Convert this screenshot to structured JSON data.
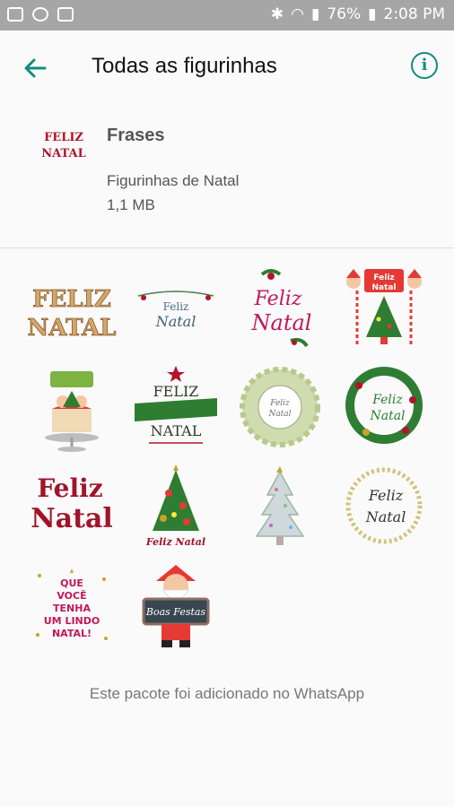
{
  "status_bar": {
    "battery": "76%",
    "time": "2:08 PM"
  },
  "app_bar": {
    "title": "Todas as figurinhas"
  },
  "pack": {
    "name": "Frases",
    "publisher": "Figurinhas de Natal",
    "size": "1,1 MB",
    "thumb_text": [
      "FELIZ",
      "NATAL"
    ]
  },
  "stickers": [
    {
      "text": [
        "FELIZ",
        "NATAL"
      ]
    },
    {
      "text": [
        "Feliz",
        "Natal"
      ]
    },
    {
      "text": [
        "Feliz",
        "Natal"
      ]
    },
    {
      "text": [
        "Feliz",
        "Natal"
      ]
    },
    {
      "text": []
    },
    {
      "text": [
        "FELIZ",
        "NATAL"
      ]
    },
    {
      "text": [
        "Feliz",
        "Natal"
      ]
    },
    {
      "text": [
        "Feliz",
        "Natal"
      ]
    },
    {
      "text": [
        "Feliz",
        "Natal"
      ]
    },
    {
      "text": [
        "Feliz Natal"
      ]
    },
    {
      "text": []
    },
    {
      "text": [
        "Feliz",
        "Natal"
      ]
    },
    {
      "text": [
        "QUE",
        "VOCÊ",
        "TENHA",
        "UM LINDO",
        "NATAL!"
      ]
    },
    {
      "text": [
        "Boas Festas"
      ]
    }
  ],
  "footer": {
    "text": "Este pacote foi adicionado no WhatsApp"
  },
  "colors": {
    "accent": "#128c7e",
    "red": "#b3142b",
    "green": "#2e7d32",
    "gold": "#c9a227"
  }
}
